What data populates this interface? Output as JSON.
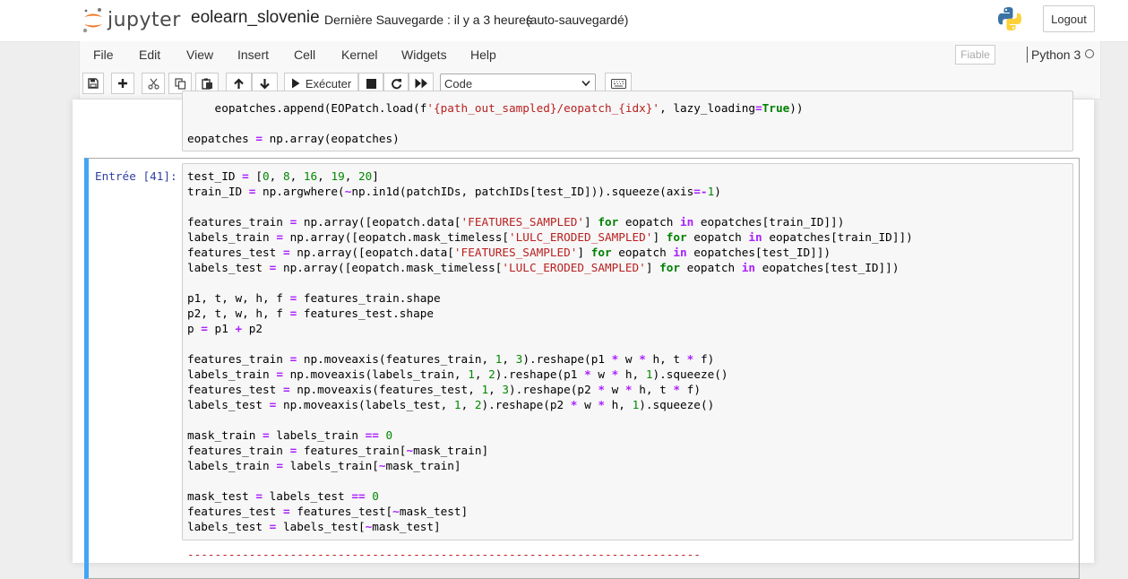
{
  "header": {
    "logo_text": "jupyter",
    "notebook_name": "eolearn_slovenie",
    "save_status": "Dernière Sauvegarde : il y a 3 heures",
    "autosave": "(auto-sauvegardé)",
    "logout_label": "Logout"
  },
  "menu": {
    "items": [
      "File",
      "Edit",
      "View",
      "Insert",
      "Cell",
      "Kernel",
      "Widgets",
      "Help"
    ],
    "trusted_label": "Fiable",
    "kernel_name": "Python 3"
  },
  "toolbar": {
    "buttons": [
      "save-icon",
      "plus-icon",
      "cut-icon",
      "copy-icon",
      "paste-icon",
      "arrow-up-icon",
      "arrow-down-icon",
      "play-icon",
      "stop-icon",
      "restart-icon",
      "fast-forward-icon",
      "keyboard-icon"
    ],
    "run_label": "Exécuter",
    "cell_type": "Code"
  },
  "cells": [
    {
      "prompt": "",
      "lines": [
        "    eopatches.append(EOPatch.load(f'{path_out_sampled}/eopatch_{idx}', lazy_loading=True))",
        "",
        "eopatches = np.array(eopatches)"
      ]
    },
    {
      "prompt": "Entrée [41]:",
      "lines": [
        "test_ID = [0, 8, 16, 19, 20]",
        "train_ID = np.argwhere(~np.in1d(patchIDs, patchIDs[test_ID])).squeeze(axis=-1)",
        "",
        "features_train = np.array([eopatch.data['FEATURES_SAMPLED'] for eopatch in eopatches[train_ID]])",
        "labels_train = np.array([eopatch.mask_timeless['LULC_ERODED_SAMPLED'] for eopatch in eopatches[train_ID]])",
        "features_test = np.array([eopatch.data['FEATURES_SAMPLED'] for eopatch in eopatches[test_ID]])",
        "labels_test = np.array([eopatch.mask_timeless['LULC_ERODED_SAMPLED'] for eopatch in eopatches[test_ID]])",
        "",
        "p1, t, w, h, f = features_train.shape",
        "p2, t, w, h, f = features_test.shape",
        "p = p1 + p2",
        "",
        "features_train = np.moveaxis(features_train, 1, 3).reshape(p1 * w * h, t * f)",
        "labels_train = np.moveaxis(labels_train, 1, 2).reshape(p1 * w * h, 1).squeeze()",
        "features_test = np.moveaxis(features_test, 1, 3).reshape(p2 * w * h, t * f)",
        "labels_test = np.moveaxis(labels_test, 1, 2).reshape(p2 * w * h, 1).squeeze()",
        "",
        "mask_train = labels_train == 0",
        "features_train = features_train[~mask_train]",
        "labels_train = labels_train[~mask_train]",
        "",
        "mask_test = labels_test == 0",
        "features_test = features_test[~mask_test]",
        "labels_test = labels_test[~mask_test]"
      ],
      "output_text": "---------------------------------------------------------------------------"
    }
  ],
  "colors": {
    "keyword": "#008000",
    "operator": "#aa22ff",
    "string": "#ba2121",
    "number": "#008800",
    "prompt": "#303f9f",
    "selected_border": "#42a5f5"
  }
}
